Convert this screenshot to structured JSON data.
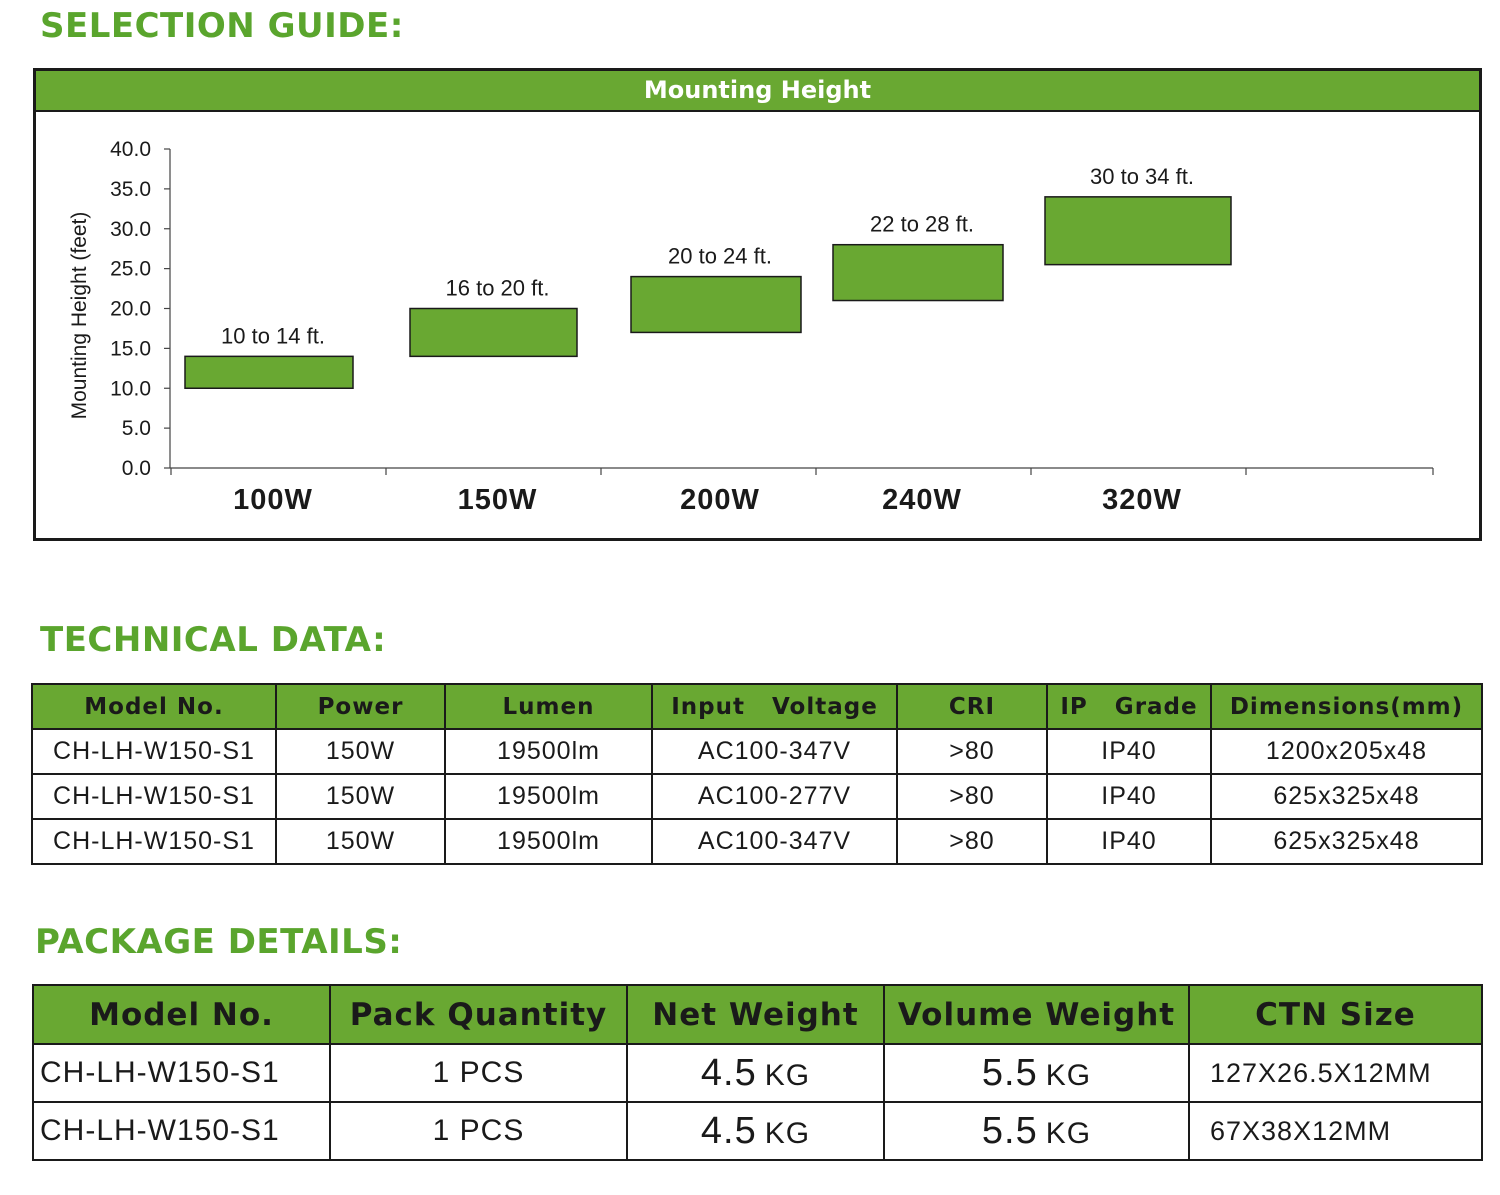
{
  "sections": {
    "selection_guide": "SELECTION GUIDE:",
    "technical_data": "TECHNICAL DATA:",
    "package_details": "PACKAGE DETAILS:"
  },
  "colors": {
    "accent_green": "#69a832",
    "title_green": "#5aa52d",
    "border": "#1a1a1a"
  },
  "chart_data": {
    "type": "bar",
    "title": "Mounting Height",
    "ylabel": "Mounting Height (feet)",
    "xlabel": "",
    "ylim": [
      0,
      40
    ],
    "yticks": [
      "0.0",
      "5.0",
      "10.0",
      "15.0",
      "20.0",
      "25.0",
      "30.0",
      "35.0",
      "40.0"
    ],
    "categories": [
      "100W",
      "150W",
      "200W",
      "240W",
      "320W"
    ],
    "ranges": [
      {
        "low": 10,
        "high": 14,
        "label": "10 to 14 ft."
      },
      {
        "low": 14,
        "high": 20,
        "label": "16 to 20 ft."
      },
      {
        "low": 17,
        "high": 24,
        "label": "20 to 24 ft."
      },
      {
        "low": 21,
        "high": 28,
        "label": "22 to 28 ft."
      },
      {
        "low": 25.5,
        "high": 34,
        "label": "30 to 34 ft."
      }
    ],
    "grid": false,
    "bar_color": "#69a832"
  },
  "technical": {
    "headers": [
      "Model No.",
      "Power",
      "Lumen",
      "Input   Voltage",
      "CRI",
      "IP   Grade",
      "Dimensions(mm)"
    ],
    "rows": [
      [
        "CH-LH-W150-S1",
        "150W",
        "19500lm",
        "AC100-347V",
        ">80",
        "IP40",
        "1200x205x48"
      ],
      [
        "CH-LH-W150-S1",
        "150W",
        "19500lm",
        "AC100-277V",
        ">80",
        "IP40",
        "625x325x48"
      ],
      [
        "CH-LH-W150-S1",
        "150W",
        "19500lm",
        "AC100-347V",
        ">80",
        "IP40",
        "625x325x48"
      ]
    ]
  },
  "package": {
    "headers": [
      "Model No.",
      "Pack Quantity",
      "Net Weight",
      "Volume Weight",
      "CTN Size"
    ],
    "rows": [
      {
        "model": "CH-LH-W150-S1",
        "qty": "1 PCS",
        "net": "4.5",
        "net_unit": "KG",
        "vol": "5.5",
        "vol_unit": "KG",
        "ctn": "127X26.5X12MM"
      },
      {
        "model": "CH-LH-W150-S1",
        "qty": "1 PCS",
        "net": "4.5",
        "net_unit": "KG",
        "vol": "5.5",
        "vol_unit": "KG",
        "ctn": "67X38X12MM"
      }
    ]
  }
}
